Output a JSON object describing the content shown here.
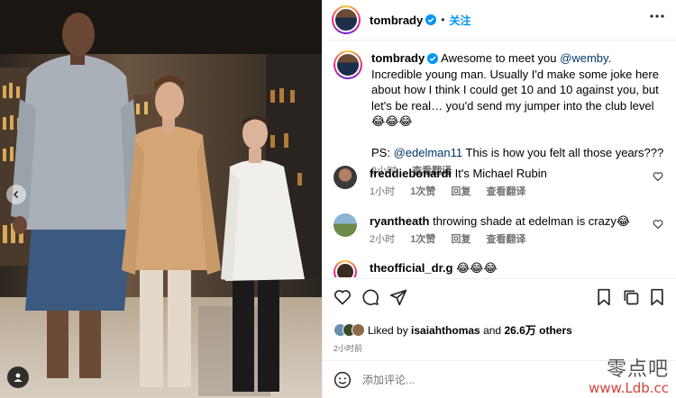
{
  "post": {
    "author": "tombrady",
    "follow_label": "关注",
    "dot": "•",
    "caption_main": "Awesome to meet you ",
    "caption_mention": "@wemby",
    "caption_rest": ". Incredible young man. Usually I'd make some joke here about how I think I could get 10 and 10 against you, but let's be real… you'd send my jumper into the club level 😂😂😂",
    "caption_ps_prefix": "PS: ",
    "caption_ps_mention": "@edelman11",
    "caption_ps_rest": " This is how you felt all those years???",
    "caption_time": "2小时",
    "caption_translate": "查看翻译"
  },
  "comments": [
    {
      "user": "freddiebonardi",
      "text": "It's Michael Rubin",
      "time": "1小时",
      "likes": "1次赞",
      "reply": "回复",
      "translate": "查看翻译"
    },
    {
      "user": "ryantheath",
      "text": "throwing shade at edelman is crazy😂",
      "time": "2小时",
      "likes": "1次赞",
      "reply": "回复",
      "translate": "查看翻译"
    },
    {
      "user": "theofficial_dr.g",
      "text": "😂😂😂",
      "time": "",
      "likes": "",
      "reply": "",
      "translate": ""
    }
  ],
  "likes": {
    "prefix": "Liked by ",
    "user": "isaiahthomas",
    "middle": " and ",
    "count": "26.6万",
    "suffix": " others",
    "time": "2小时前"
  },
  "add_comment": {
    "placeholder": "添加评论..."
  },
  "watermark": {
    "cn": "零点吧",
    "url": "www.Ldb.cc"
  },
  "icons": [
    "more-icon",
    "heart-icon",
    "comment-icon",
    "share-icon",
    "save-icon",
    "verified-icon",
    "emoji-icon",
    "prev-arrow-icon",
    "user-tag-icon"
  ],
  "colors": {
    "accent": "#0095f6",
    "mention": "#00376b",
    "muted": "#737373",
    "watermark_url": "#d1423a"
  }
}
